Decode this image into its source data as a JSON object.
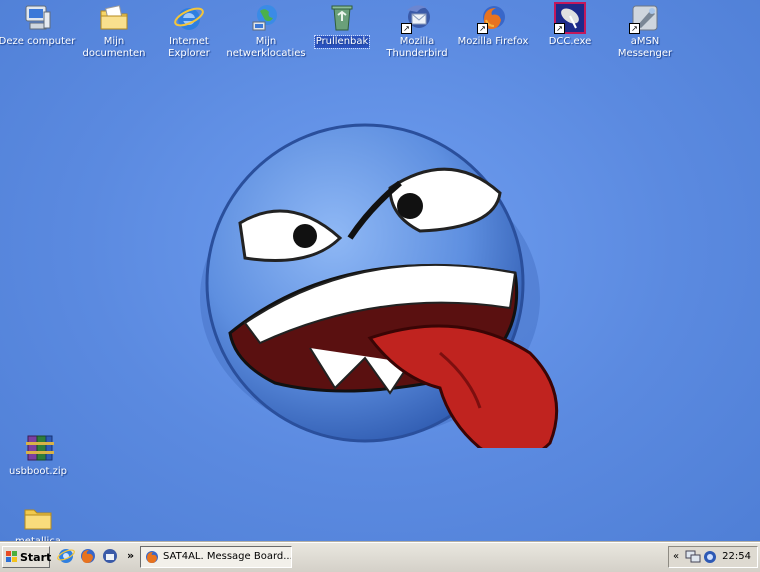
{
  "desktop": {
    "icons": [
      {
        "label": "Deze computer"
      },
      {
        "label": "Mijn documenten"
      },
      {
        "label": "Internet Explorer"
      },
      {
        "label": "Mijn netwerklocaties"
      },
      {
        "label": "Prullenbak"
      },
      {
        "label": "Mozilla Thunderbird"
      },
      {
        "label": "Mozilla Firefox"
      },
      {
        "label": "DCC.exe"
      },
      {
        "label": "aMSN Messenger"
      },
      {
        "label": "usbboot.zip"
      },
      {
        "label": "metallica"
      }
    ],
    "selected_icon": "Prullenbak"
  },
  "taskbar": {
    "start_label": "Start",
    "chevron": "»",
    "task_label": "SAT4AL. Message Board...",
    "tray_arrow": "«",
    "clock": "22:54"
  },
  "colors": {
    "desktop": "#5c8ee6",
    "selection": "#2a52be",
    "taskbar": "#d4d0c8"
  }
}
